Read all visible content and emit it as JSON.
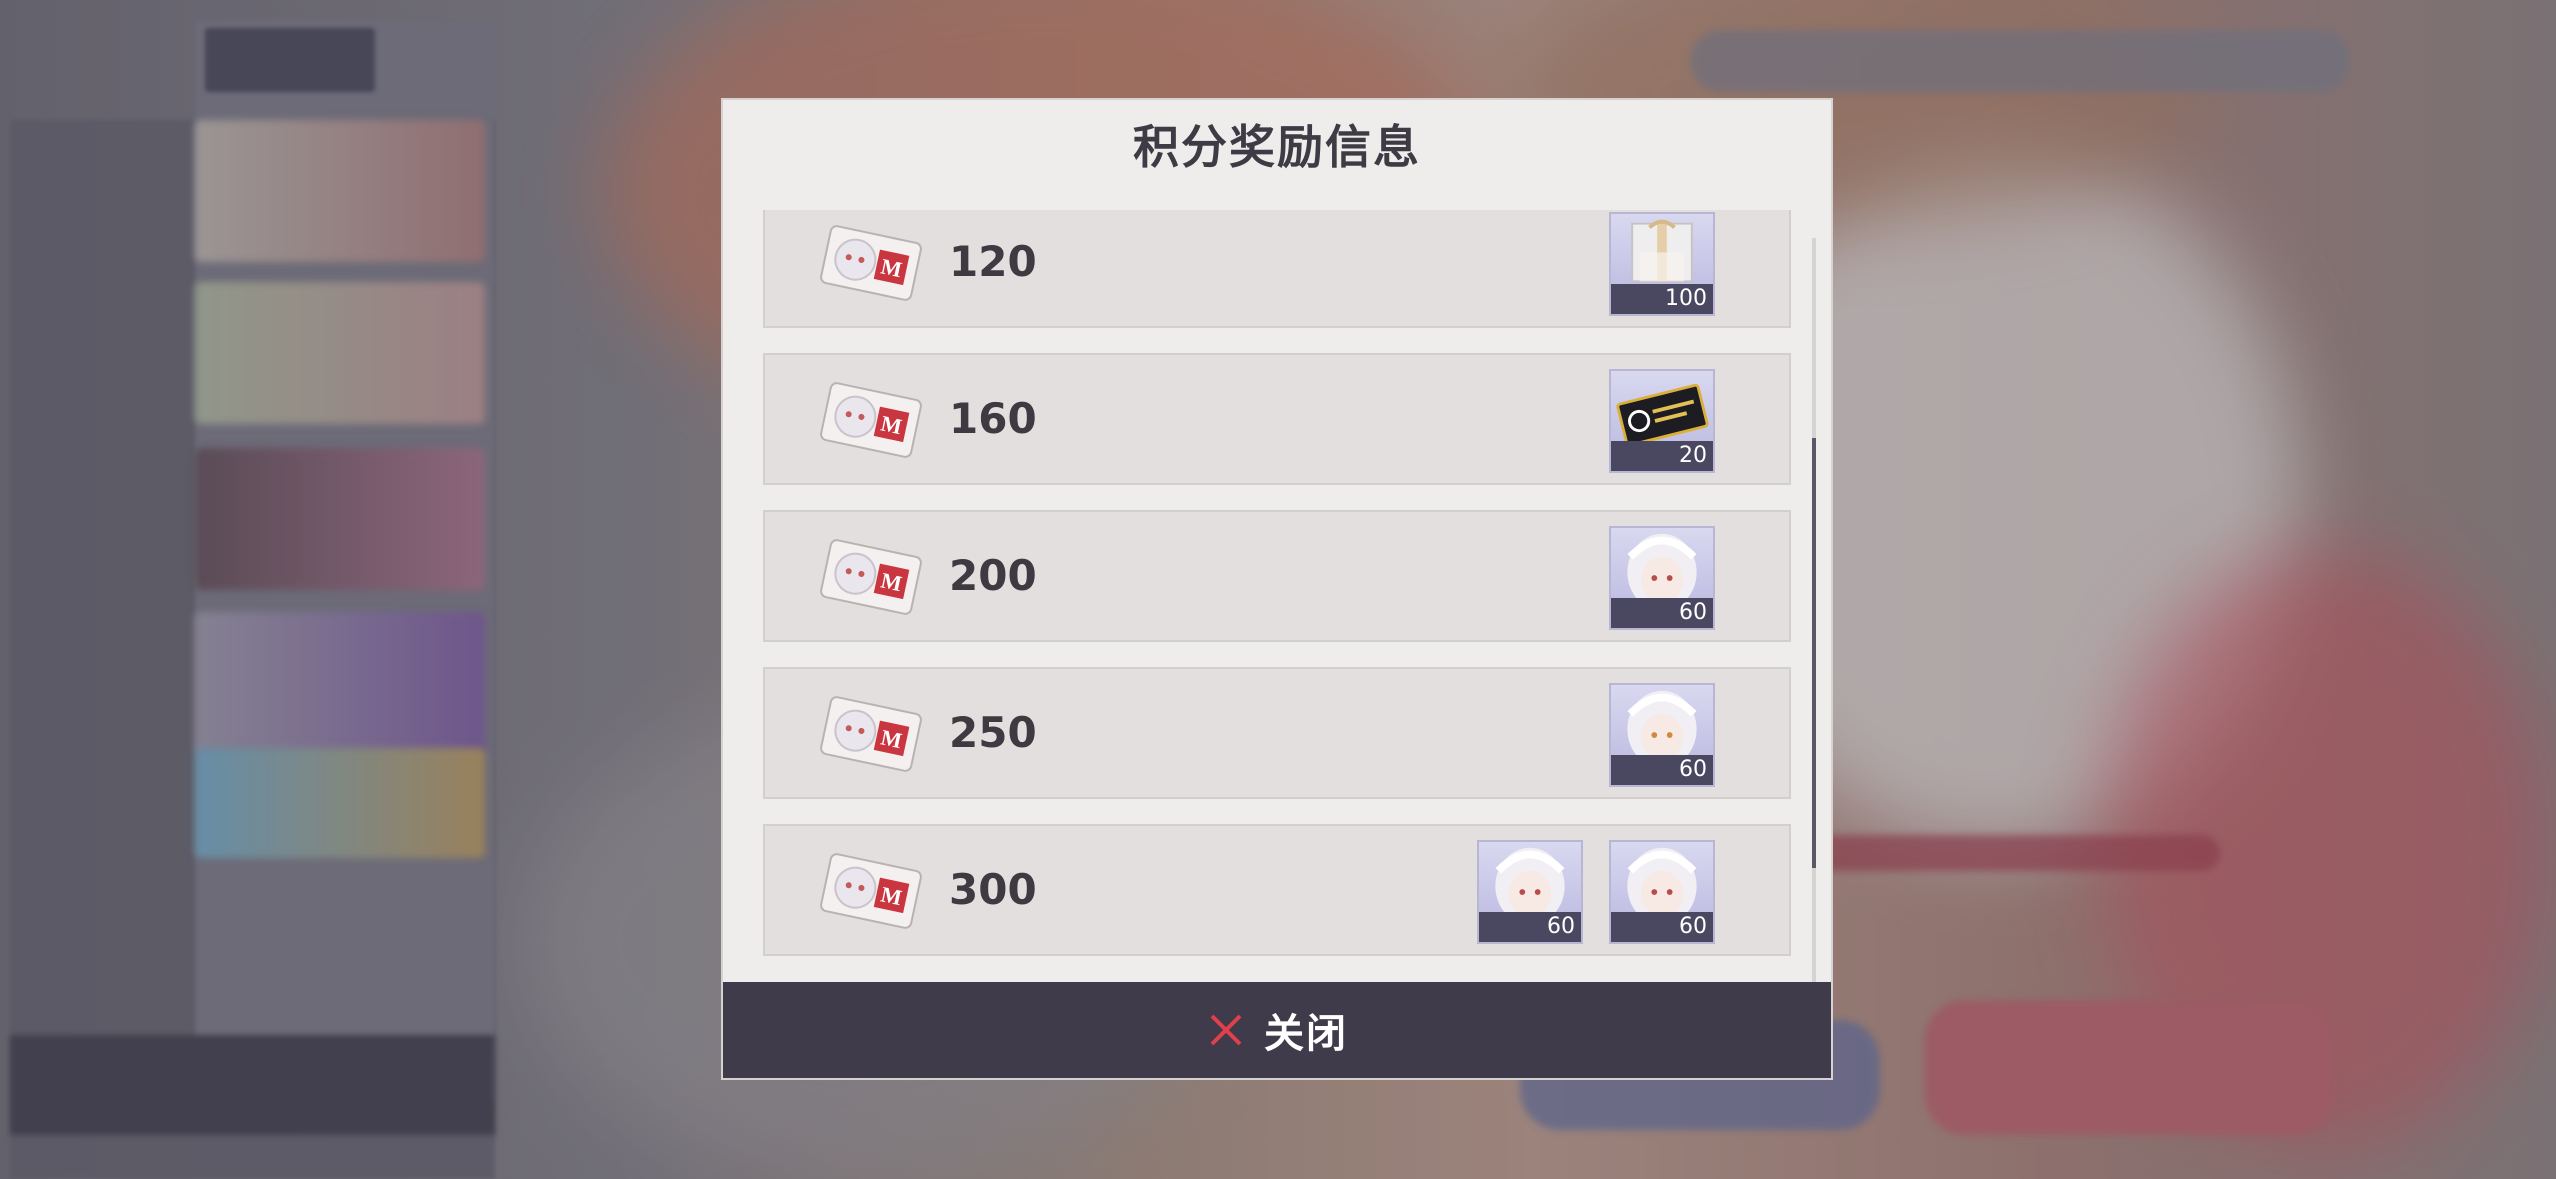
{
  "modal": {
    "title": "积分奖励信息",
    "close_label": "关闭"
  },
  "rewards": [
    {
      "points": "120",
      "items": [
        {
          "icon": "gift-box-icon",
          "count": "100"
        }
      ]
    },
    {
      "points": "160",
      "items": [
        {
          "icon": "black-ticket-icon",
          "count": "20"
        }
      ]
    },
    {
      "points": "200",
      "items": [
        {
          "icon": "character-portrait-icon",
          "count": "60"
        }
      ]
    },
    {
      "points": "250",
      "items": [
        {
          "icon": "character-portrait-icon",
          "count": "60"
        }
      ]
    },
    {
      "points": "300",
      "items": [
        {
          "icon": "character-portrait-icon",
          "count": "60"
        },
        {
          "icon": "character-portrait-icon",
          "count": "60"
        }
      ]
    }
  ],
  "colors": {
    "close_bar": "#3f3b4a",
    "close_icon": "#e0404c",
    "count_badge": "#4a4860"
  }
}
